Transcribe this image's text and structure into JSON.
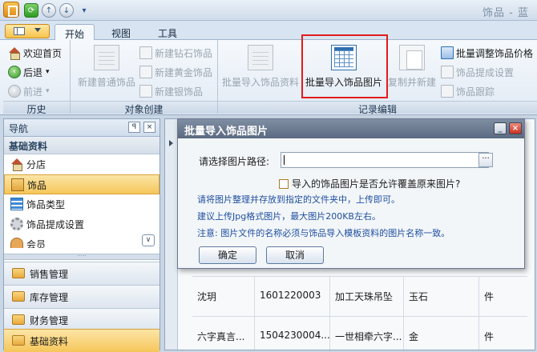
{
  "window": {
    "title": "饰品 - 蓝"
  },
  "quick_access": {
    "refresh": "⟳",
    "up": "↑",
    "down": "↓",
    "dropdown": "▾"
  },
  "ribbon_tabs": [
    "开始",
    "视图",
    "工具"
  ],
  "ribbon": {
    "history": {
      "label": "历史",
      "home": "欢迎首页",
      "back": "后退",
      "forward": "前进"
    },
    "object_create": {
      "label": "对象创建",
      "new_regular": "新建普通饰品",
      "new_diamond": "新建钻石饰品",
      "new_gold": "新建黄金饰品",
      "new_silver": "新建银饰品"
    },
    "record_edit": {
      "label": "记录编辑",
      "batch_import_data": "批量导入饰品资料",
      "batch_import_images": "批量导入饰品图片",
      "copy_new": "复制并新建",
      "batch_adjust_price": "批量调整饰品价格",
      "commission_settings": "饰品提成设置",
      "tracking": "饰品跟踪"
    }
  },
  "nav": {
    "title": "导航",
    "pin": "ꟼ",
    "close": "×",
    "section": "基础资料",
    "items": [
      "分店",
      "饰品",
      "饰品类型",
      "饰品提成设置",
      "会员"
    ],
    "groups": [
      "销售管理",
      "库存管理",
      "财务管理",
      "基础资料"
    ]
  },
  "table": {
    "rows": [
      [
        "沈玥",
        "1601220003",
        "加工天珠吊坠",
        "玉石",
        "件"
      ],
      [
        "六字真言...",
        "1504230004...",
        "一世相牵六字...",
        "金",
        "件"
      ]
    ]
  },
  "dialog": {
    "title": "批量导入饰品图片",
    "path_label": "请选择图片路径:",
    "path_value": "",
    "browse": "···",
    "overwrite_label": "导入的饰品图片是否允许覆盖原来图片?",
    "notes": [
      "请将图片整理并存放到指定的文件夹中，上传即可。",
      "建议上传Jpg格式图片，最大图片200KB左右。",
      "注意: 图片文件的名称必须与饰品导入模板资料的图片名称一致。"
    ],
    "ok": "确定",
    "cancel": "取消",
    "minimize": "_",
    "close": "×"
  }
}
